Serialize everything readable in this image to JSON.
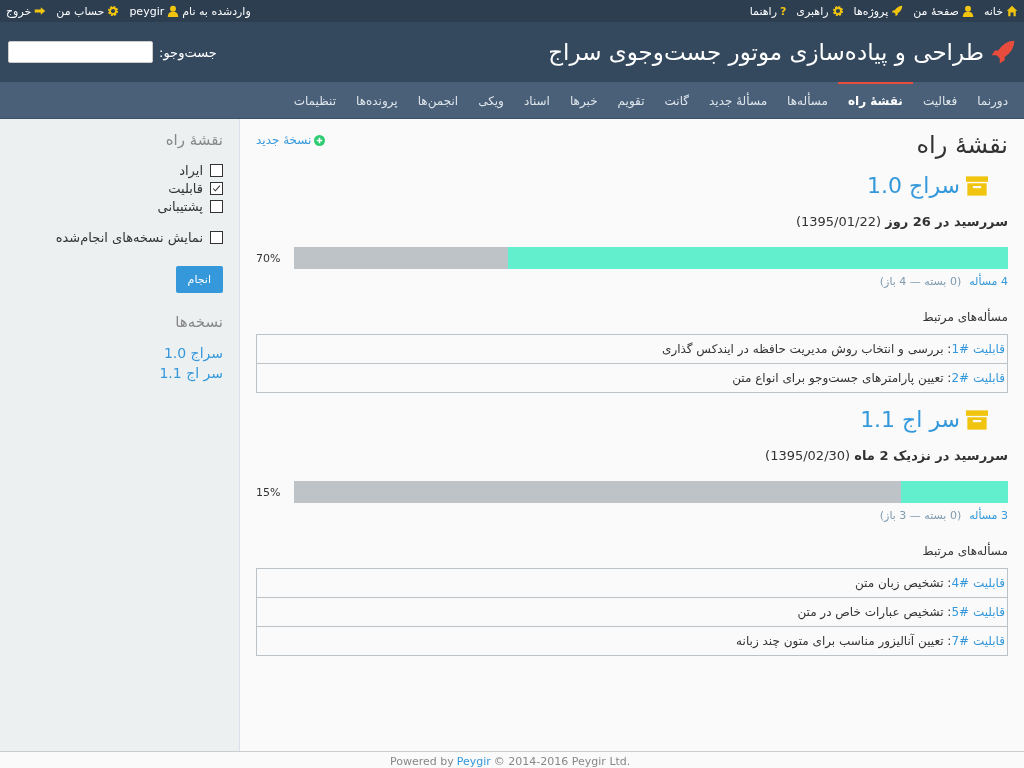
{
  "top_bar": {
    "right_links": [
      {
        "label": "خانه",
        "kind": "home"
      },
      {
        "label": "صفحهٔ من",
        "kind": "user"
      },
      {
        "label": "پروژه‌ها",
        "kind": "rocket"
      },
      {
        "label": "راهبری",
        "kind": "gear"
      },
      {
        "label": "راهنما",
        "kind": "help",
        "icon_char": "?"
      }
    ],
    "logged_in_label": "واردشده به نام",
    "username": "peygir",
    "left_links": [
      {
        "label": "حساب من",
        "kind": "gear"
      },
      {
        "label": "خروج",
        "kind": "arrow"
      }
    ]
  },
  "header": {
    "title": "طراحی و پیاده‌سازی موتور جست‌وجوی سراج",
    "search_label": "جست‌وجو:"
  },
  "tabs": [
    {
      "label": "دورنما",
      "selected": false
    },
    {
      "label": "فعالیت",
      "selected": false
    },
    {
      "label": "نقشهٔ راه",
      "selected": true
    },
    {
      "label": "مسأله‌ها",
      "selected": false
    },
    {
      "label": "مسألهٔ جدید",
      "selected": false
    },
    {
      "label": "گانت",
      "selected": false
    },
    {
      "label": "تقویم",
      "selected": false
    },
    {
      "label": "خبرها",
      "selected": false
    },
    {
      "label": "اسناد",
      "selected": false
    },
    {
      "label": "ویکی",
      "selected": false
    },
    {
      "label": "انجمن‌ها",
      "selected": false
    },
    {
      "label": "پرونده‌ها",
      "selected": false
    },
    {
      "label": "تنظیمات",
      "selected": false
    }
  ],
  "main": {
    "title": "نقشهٔ راه",
    "new_version_link": "نسخهٔ جدید",
    "versions": [
      {
        "name": "سراج 1.0",
        "due": "**سررسید در 26 روز** (1395/01/22)",
        "level": 0.7,
        "percent": "70%",
        "issues_count": "4 مسأله",
        "breakdown": "(0 بسته — 4 باز)",
        "related_title": "مسأله‌های مرتبط",
        "issues": [
          {
            "tracker": "قابلیت #1",
            "subject": ": بررسی و انتخاب روش مدیریت حافظه در ایندکس گذاری"
          },
          {
            "tracker": "قابلیت #2",
            "subject": ": تعیین پارامترهای جست‌وجو برای انواع متن"
          }
        ]
      },
      {
        "name": "سر اج 1.1",
        "due": "**سررسید در نزدیک 2 ماه** (1395/02/30)",
        "level": 0.15,
        "percent": "15%",
        "issues_count": "3 مسأله",
        "breakdown": "(0 بسته — 3 باز)",
        "related_title": "مسأله‌های مرتبط",
        "issues": [
          {
            "tracker": "قابلیت #4",
            "subject": ": تشخیص زبان متن"
          },
          {
            "tracker": "قابلیت #5",
            "subject": ": تشخیص عبارات خاص در متن"
          },
          {
            "tracker": "قابلیت #7",
            "subject": ": تعیین آنالیزور مناسب برای متون چند زبانه"
          }
        ]
      }
    ]
  },
  "sidebar": {
    "title": "نقشهٔ راه",
    "trackers": [
      {
        "label": "ایراد",
        "checked": false
      },
      {
        "label": "قابلیت",
        "checked": true
      },
      {
        "label": "پشتیبانی",
        "checked": false
      }
    ],
    "completed": {
      "label": "نمایش نسخه‌های انجام‌شده",
      "checked": false
    },
    "apply_button": "انجام",
    "versions_title": "نسخه‌ها",
    "versions": [
      "سراج 1.0",
      "سر اج 1.1"
    ]
  },
  "footer": {
    "prefix": "Powered by",
    "link": "Peygir",
    "suffix": "© 2014-2016 Peygir Ltd."
  }
}
